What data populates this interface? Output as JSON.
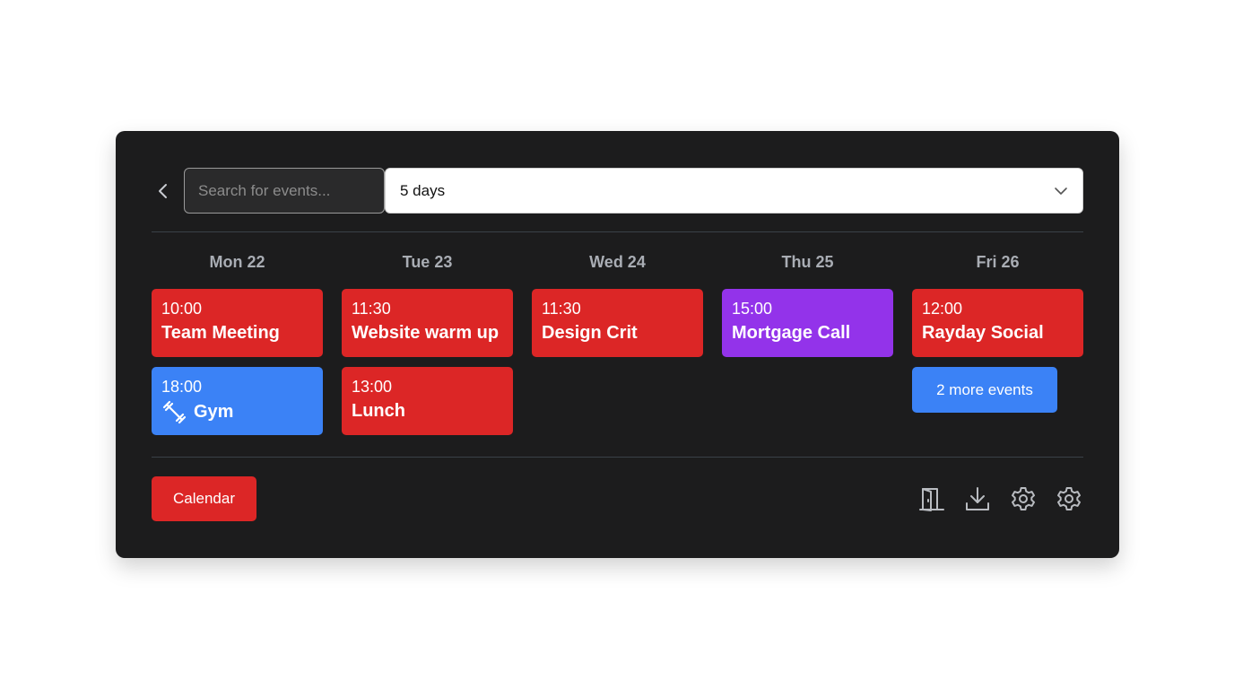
{
  "colors": {
    "panel": "#1c1c1d",
    "red": "#dc2626",
    "blue": "#3b82f6",
    "purple": "#9333ea",
    "muted": "#a9adb4",
    "icon": "#b9bcc1"
  },
  "toolbar": {
    "back_icon": "chevron-left-icon",
    "search_placeholder": "Search for events...",
    "range_value": "5 days",
    "range_icon": "chevron-down-icon"
  },
  "days": [
    {
      "label": "Mon 22",
      "events": [
        {
          "time": "10:00",
          "title": "Team Meeting",
          "color": "red"
        },
        {
          "time": "18:00",
          "title": "Gym",
          "color": "blue",
          "icon": "dumbbell-icon"
        }
      ]
    },
    {
      "label": "Tue 23",
      "events": [
        {
          "time": "11:30",
          "title": "Website warm up",
          "color": "red"
        },
        {
          "time": "13:00",
          "title": "Lunch",
          "color": "red"
        }
      ]
    },
    {
      "label": "Wed 24",
      "events": [
        {
          "time": "11:30",
          "title": "Design Crit",
          "color": "red"
        }
      ]
    },
    {
      "label": "Thu 25",
      "events": [
        {
          "time": "15:00",
          "title": "Mortgage Call",
          "color": "purple"
        }
      ]
    },
    {
      "label": "Fri 26",
      "events": [
        {
          "time": "12:00",
          "title": "Rayday Social",
          "color": "red"
        }
      ],
      "more_label": "2 more events"
    }
  ],
  "footer": {
    "calendar_label": "Calendar",
    "icons": [
      "door-icon",
      "download-icon",
      "gear-icon",
      "gear-icon"
    ]
  }
}
